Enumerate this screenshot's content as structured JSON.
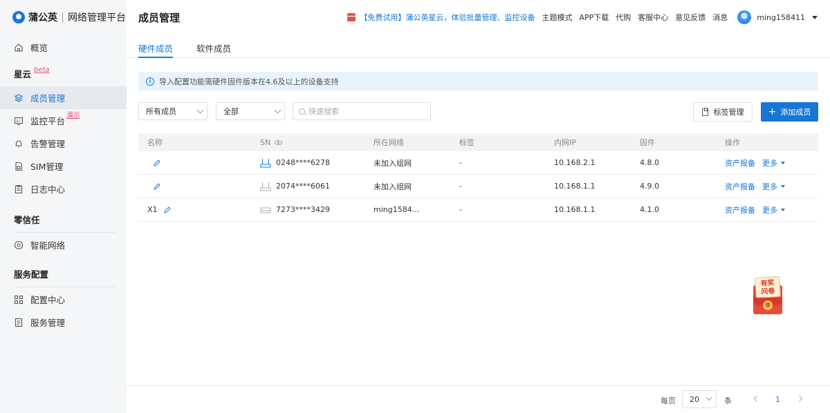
{
  "brand": {
    "name": "蒲公英",
    "subtitle": "网络管理平台"
  },
  "sidebar": {
    "overview": "概览",
    "sections": [
      {
        "title": "星云",
        "badge": "beta"
      },
      {
        "title": "零信任"
      },
      {
        "title": "服务配置"
      }
    ],
    "items": {
      "members": "成员管理",
      "monitor": "监控平台",
      "monitor_badge": "演示",
      "alerts": "告警管理",
      "sim": "SIM管理",
      "logs": "日志中心",
      "smart_network": "智能网络",
      "config_center": "配置中心",
      "service_mgmt": "服务管理"
    }
  },
  "header": {
    "title": "成员管理",
    "promo": "【免费试用】蒲公英星云，体验批量管理、监控设备",
    "links": [
      "主题模式",
      "APP下载",
      "代购",
      "客服中心",
      "意见反馈",
      "消息"
    ],
    "username": "ming158411"
  },
  "tabs": [
    "硬件成员",
    "软件成员"
  ],
  "notice": "导入配置功能需硬件固件版本在4.6及以上的设备支持",
  "filters": {
    "member_select": "所有成员",
    "status_select": "全部",
    "search_placeholder": "快速搜索",
    "tag_button": "标签管理",
    "add_button": "添加成员"
  },
  "table": {
    "headers": [
      "名称",
      "SN",
      "所在网络",
      "标签",
      "内网IP",
      "固件",
      "操作"
    ],
    "rows": [
      {
        "name": "",
        "device": "router-blue",
        "sn": "0248****6278",
        "network": "未加入组网",
        "tag": "-",
        "ip": "10.168.2.1",
        "firmware": "4.8.0",
        "action": "资产报备",
        "more": "更多"
      },
      {
        "name": "",
        "device": "router-gray",
        "sn": "2074****6061",
        "network": "未加入组网",
        "tag": "-",
        "ip": "10.168.1.1",
        "firmware": "4.9.0",
        "action": "资产报备",
        "more": "更多"
      },
      {
        "name": "X1",
        "device": "box-gray",
        "sn": "7273****3429",
        "network": "ming1584...",
        "tag": "-",
        "ip": "10.168.1.1",
        "firmware": "4.1.0",
        "action": "资产报备",
        "more": "更多"
      }
    ]
  },
  "prize": {
    "line1": "有奖",
    "line2": "问卷",
    "coin": "领"
  },
  "pagination": {
    "per_page_label": "每页",
    "per_page": "20",
    "unit": "条",
    "current_page": "1"
  },
  "colors": {
    "accent": "#1677d8",
    "promo_red": "#e25546"
  }
}
